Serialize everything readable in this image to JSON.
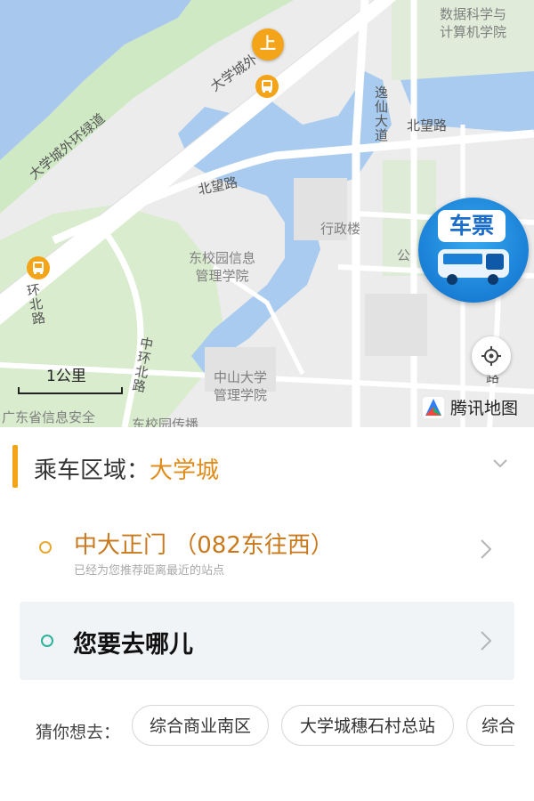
{
  "map": {
    "labels": {
      "data_school": "数据科学与\n计算机学院",
      "yixian": "逸仙大道",
      "beiwang_right": "北望路",
      "beiwang_left": "北望路",
      "outer_road": "大学城外环绿道",
      "outer_road_top": "大学城外",
      "east_campus_info": "东校园信息\n管理学院",
      "admin": "行政楼",
      "gong": "公",
      "zhongshan_mgmt": "中山大学\n管理学院",
      "ring_north": "环北路",
      "zhonghuan_north": "中环北路",
      "guangdong_info": "广东省信息安全",
      "east_media": "东校园传播",
      "right_road_fragment": "东路"
    },
    "board_marker": "上",
    "ticket_button": {
      "label": "车票"
    },
    "scale": {
      "text": "1公里"
    },
    "brand": {
      "text": "腾讯地图"
    }
  },
  "panel": {
    "area": {
      "label": "乘车区域：",
      "value": "大学城"
    },
    "stop": {
      "name": "中大正门 （082东往西）",
      "sub": "已经为您推荐距离最近的站点"
    },
    "destination": {
      "placeholder": "您要去哪儿"
    },
    "guess": {
      "label": "猜你想去：",
      "chips": [
        "综合商业南区",
        "大学城穗石村总站",
        "综合"
      ]
    }
  },
  "colors": {
    "accent_orange": "#f4a418",
    "stop_text": "#c8791c",
    "dest_dot": "#2bb39a",
    "ticket_blue": "#1a7fd6"
  }
}
